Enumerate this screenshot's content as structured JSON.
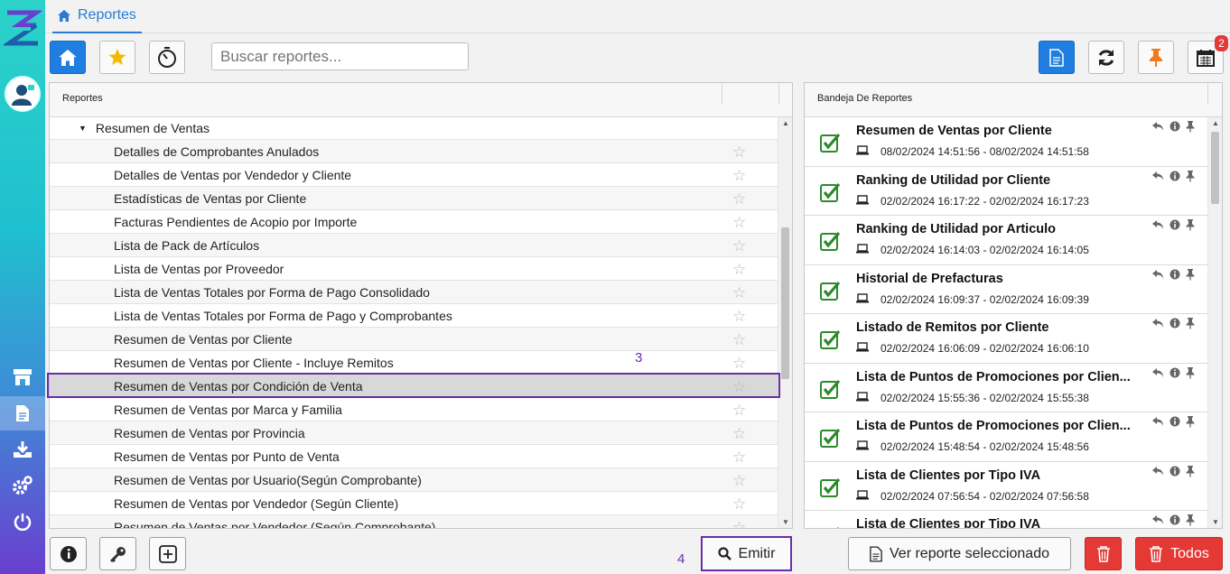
{
  "tab": {
    "label": "Reportes"
  },
  "search": {
    "placeholder": "Buscar reportes..."
  },
  "toolbar": {
    "calendar_badge": "2"
  },
  "left_panel": {
    "header": "Reportes",
    "group": "Resumen de Ventas",
    "items": [
      "Detalles de Comprobantes Anulados",
      "Detalles de Ventas por Vendedor y Cliente",
      "Estadísticas de Ventas por Cliente",
      "Facturas Pendientes de Acopio por Importe",
      "Lista de Pack de Artículos",
      "Lista de Ventas por Proveedor",
      "Lista de Ventas Totales por Forma de Pago Consolidado",
      "Lista de Ventas Totales por Forma de Pago y Comprobantes",
      "Resumen de Ventas por Cliente",
      "Resumen de Ventas por Cliente - Incluye Remitos",
      "Resumen de Ventas por Condición de Venta",
      "Resumen de Ventas por Marca y Familia",
      "Resumen de Ventas por Provincia",
      "Resumen de Ventas por Punto de Venta",
      "Resumen de Ventas por Usuario(Según Comprobante)",
      "Resumen de Ventas por Vendedor (Según Cliente)",
      "Resumen de Ventas por Vendedor (Según Comprobante)"
    ]
  },
  "right_panel": {
    "header": "Bandeja De Reportes",
    "items": [
      {
        "title": "Resumen de Ventas por Cliente",
        "date": "08/02/2024 14:51:56 - 08/02/2024 14:51:58"
      },
      {
        "title": "Ranking de Utilidad por Cliente",
        "date": "02/02/2024 16:17:22 - 02/02/2024 16:17:23"
      },
      {
        "title": "Ranking de Utilidad por Articulo",
        "date": "02/02/2024 16:14:03 - 02/02/2024 16:14:05"
      },
      {
        "title": "Historial de Prefacturas",
        "date": "02/02/2024 16:09:37 - 02/02/2024 16:09:39"
      },
      {
        "title": "Listado de Remitos por Cliente",
        "date": "02/02/2024 16:06:09 - 02/02/2024 16:06:10"
      },
      {
        "title": "Lista de Puntos de Promociones por Clien...",
        "date": "02/02/2024 15:55:36 - 02/02/2024 15:55:38"
      },
      {
        "title": "Lista de Puntos de Promociones por Clien...",
        "date": "02/02/2024 15:48:54 - 02/02/2024 15:48:56"
      },
      {
        "title": "Lista de Clientes por Tipo IVA",
        "date": "02/02/2024 07:56:54 - 02/02/2024 07:56:58"
      },
      {
        "title": "Lista de Clientes por Tipo IVA",
        "date": ""
      }
    ]
  },
  "bottom": {
    "emit_label": "Emitir",
    "view_label": "Ver reporte seleccionado",
    "all_label": "Todos"
  },
  "markers": {
    "a": "3",
    "b": "4"
  }
}
